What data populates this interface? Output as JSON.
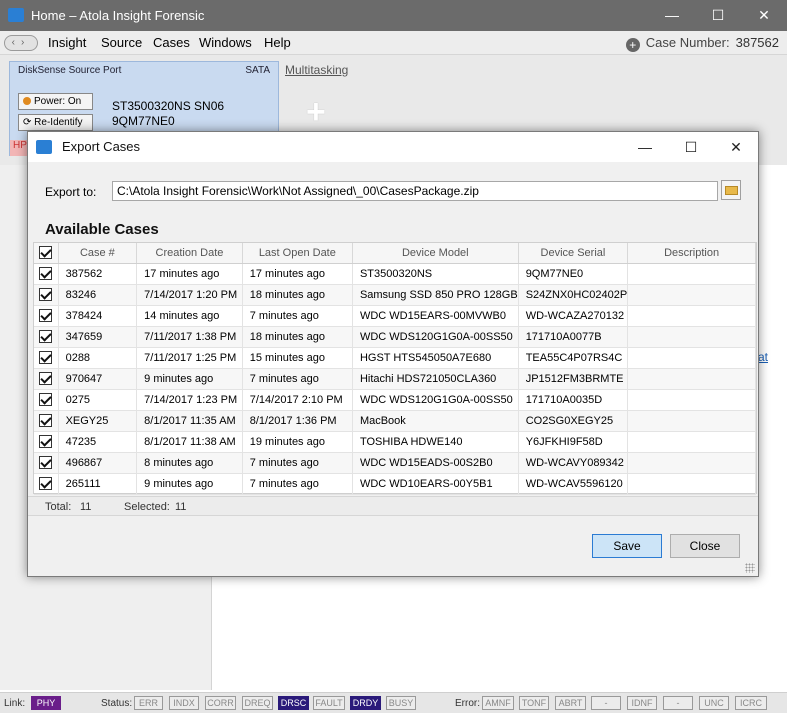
{
  "window": {
    "title": "Home – Atola Insight Forensic",
    "minimize": "—",
    "maximize": "☐",
    "close": "✕"
  },
  "menu": {
    "items": [
      "Insight",
      "Source",
      "Cases",
      "Windows",
      "Help"
    ],
    "case_number_label": "Case Number:",
    "case_number_value": "387562"
  },
  "source_port": {
    "title": "DiskSense Source Port",
    "interface": "SATA",
    "power_button": "Power: On",
    "reidentify_button": "Re-Identify",
    "model_line1": "ST3500320NS SN06",
    "model_line2": "9QM77NE0",
    "hp_label": "HP"
  },
  "multitasking_label": "Multitasking",
  "dialog": {
    "title": "Export Cases",
    "export_label": "Export to:",
    "export_path": "C:\\Atola Insight Forensic\\Work\\Not Assigned\\_00\\CasesPackage.zip",
    "section_title": "Available Cases",
    "columns": [
      "Case #",
      "Creation Date",
      "Last Open Date",
      "Device Model",
      "Device Serial",
      "Description"
    ],
    "rows": [
      [
        "387562",
        "17 minutes ago",
        "17 minutes ago",
        "ST3500320NS",
        "9QM77NE0",
        ""
      ],
      [
        "83246",
        "7/14/2017 1:20 PM",
        "18 minutes ago",
        "Samsung SSD 850 PRO 128GB",
        "S24ZNX0HC02402P",
        ""
      ],
      [
        "378424",
        "14 minutes ago",
        "7 minutes ago",
        "WDC WD15EARS-00MVWB0",
        "WD-WCAZA270132",
        ""
      ],
      [
        "347659",
        "7/11/2017 1:38 PM",
        "18 minutes ago",
        "WDC WDS120G1G0A-00SS50",
        "171710A0077B",
        ""
      ],
      [
        "0288",
        "7/11/2017 1:25 PM",
        "15 minutes ago",
        "HGST HTS545050A7E680",
        "TEA55C4P07RS4C",
        ""
      ],
      [
        "970647",
        "9 minutes ago",
        "7 minutes ago",
        "Hitachi HDS721050CLA360",
        "JP1512FM3BRMTE",
        ""
      ],
      [
        "0275",
        "7/14/2017 1:23 PM",
        "7/14/2017 2:10 PM",
        "WDC WDS120G1G0A-00SS50",
        "171710A0035D",
        ""
      ],
      [
        "XEGY25",
        "8/1/2017 11:35 AM",
        "8/1/2017 1:36 PM",
        "MacBook",
        "CO2SG0XEGY25",
        ""
      ],
      [
        "47235",
        "8/1/2017 11:38 AM",
        "19 minutes ago",
        "TOSHIBA HDWE140",
        "Y6JFKHI9F58D",
        ""
      ],
      [
        "496867",
        "8 minutes ago",
        "7 minutes ago",
        "WDC WD15EADS-00S2B0",
        "WD-WCAVY089342",
        ""
      ],
      [
        "265111",
        "9 minutes ago",
        "7 minutes ago",
        "WDC WD10EARS-00Y5B1",
        "WD-WCAV5596120",
        ""
      ]
    ],
    "total_label": "Total:",
    "total_value": "11",
    "selected_label": "Selected:",
    "selected_value": "11",
    "save_button": "Save",
    "close_button": "Close"
  },
  "right_stub": "at",
  "statusbar": {
    "link_label": "Link:",
    "link_value": "PHY",
    "status_label": "Status:",
    "status_items": [
      {
        "label": "ERR",
        "on": false
      },
      {
        "label": "INDX",
        "on": false
      },
      {
        "label": "CORR",
        "on": false
      },
      {
        "label": "DREQ",
        "on": false
      },
      {
        "label": "DRSC",
        "on": true
      },
      {
        "label": "FAULT",
        "on": false
      },
      {
        "label": "DRDY",
        "on": true
      },
      {
        "label": "BUSY",
        "on": false
      }
    ],
    "error_label": "Error:",
    "error_items": [
      "AMNF",
      "TONF",
      "ABRT",
      "-",
      "IDNF",
      "-",
      "UNC",
      "ICRC"
    ]
  },
  "colors": {
    "titlebar": "#6b6b6b",
    "accent": "#2b7bd3",
    "status_on": "#2a1a7a",
    "phy": "#6a1e8a"
  }
}
